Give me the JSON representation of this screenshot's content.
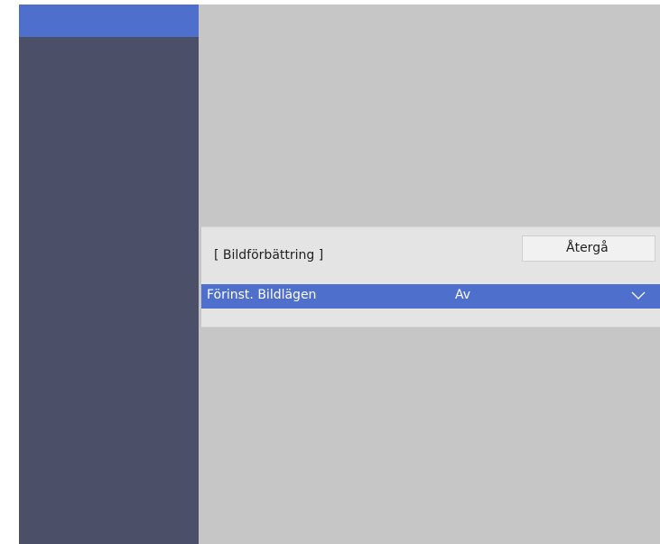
{
  "panel": {
    "title": "[ Bildförbättring ]",
    "back_button_label": "Återgå",
    "setting": {
      "label": "Förinst. Bildlägen",
      "value": "Av"
    }
  },
  "icons": {
    "dropdown": "chevron-down-icon"
  },
  "colors": {
    "sidebar": "#4b5068",
    "selection_accent": "#4f6fcc",
    "background": "#c6c6c6",
    "panel": "#e4e4e4"
  }
}
